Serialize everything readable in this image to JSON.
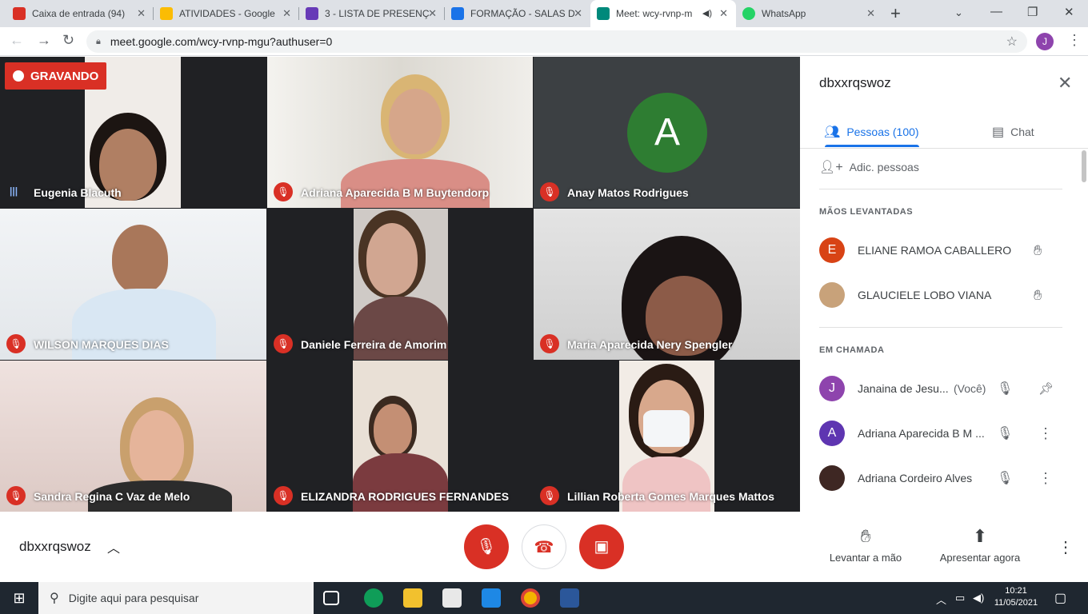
{
  "browser": {
    "tabs": [
      {
        "title": "Caixa de entrada (94)",
        "color": "#d93025"
      },
      {
        "title": "ATIVIDADES - Google",
        "color": "#fbbc04"
      },
      {
        "title": "3 - LISTA DE PRESENÇ",
        "color": "#673ab7"
      },
      {
        "title": "FORMAÇÃO - SALAS D",
        "color": "#1a73e8"
      },
      {
        "title": "Meet: wcy-rvnp-m",
        "color": "#00897b"
      },
      {
        "title": "WhatsApp",
        "color": "#25d366"
      }
    ],
    "url": "meet.google.com/wcy-rvnp-mgu?authuser=0",
    "profile_initial": "J"
  },
  "recording": {
    "label": "GRAVANDO"
  },
  "tiles": [
    {
      "name": "Eugenia Blacuth",
      "speaking": true
    },
    {
      "name": "Adriana Aparecida B M Buytendorp",
      "speaking": false
    },
    {
      "name": "Anay Matos Rodrigues",
      "speaking": false,
      "avatar": "A"
    },
    {
      "name": "WILSON MARQUES DIAS",
      "speaking": false
    },
    {
      "name": "Daniele Ferreira de Amorim",
      "speaking": false
    },
    {
      "name": "Maria Aparecida Nery Spengler",
      "speaking": false
    },
    {
      "name": "Sandra Regina C Vaz de Melo",
      "speaking": false
    },
    {
      "name": "ELIZANDRA RODRIGUES FERNANDES",
      "speaking": false
    },
    {
      "name": "Lillian Roberta Gomes Marques Mattos",
      "speaking": false
    }
  ],
  "panel": {
    "title": "dbxxrqswoz",
    "tab_people": "Pessoas (100)",
    "tab_chat": "Chat",
    "add_people": "Adic. pessoas",
    "raised_header": "MÃOS LEVANTADAS",
    "raised": [
      {
        "initial": "E",
        "name": "ELIANE RAMOA CABALLERO",
        "color": "#d84315"
      },
      {
        "initial": "",
        "name": "GLAUCIELE LOBO VIANA",
        "color": "#c8a27a"
      }
    ],
    "incall_header": "EM CHAMADA",
    "incall": [
      {
        "initial": "J",
        "name": "Janaina de Jesu...",
        "you": "(Você)",
        "color": "#8e44ad"
      },
      {
        "initial": "A",
        "name": "Adriana Aparecida B M ...",
        "you": "",
        "color": "#5e35b1"
      },
      {
        "initial": "",
        "name": "Adriana Cordeiro Alves",
        "you": "",
        "color": "#3e2723"
      }
    ]
  },
  "bottom": {
    "meeting_code": "dbxxrqswoz",
    "raise_hand": "Levantar a mão",
    "present": "Apresentar agora"
  },
  "taskbar": {
    "search_placeholder": "Digite aqui para pesquisar",
    "time": "10:21",
    "date": "11/05/2021"
  }
}
